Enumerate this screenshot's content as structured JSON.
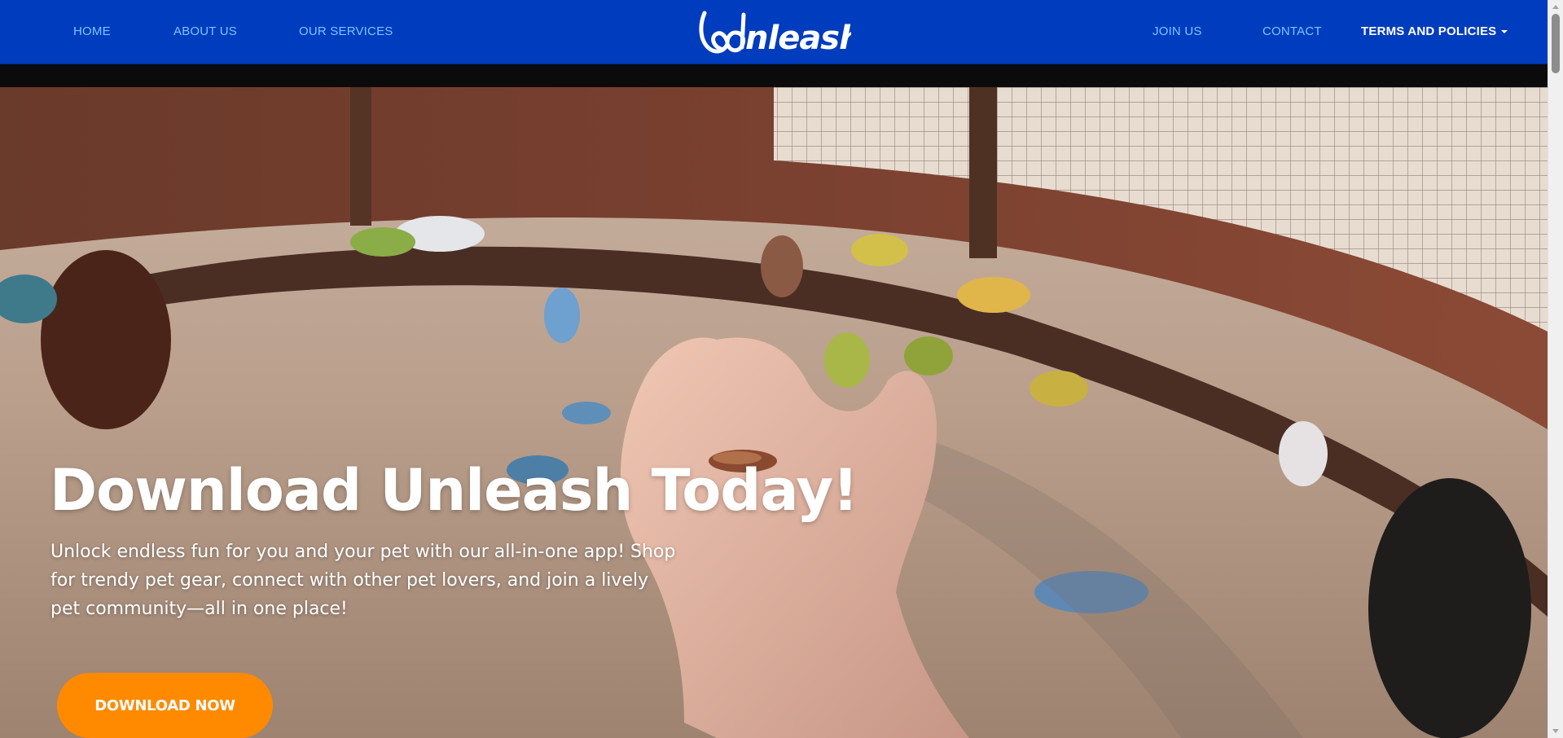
{
  "nav": {
    "home": "HOME",
    "about": "ABOUT US",
    "services": "OUR SERVICES",
    "join": "JOIN US",
    "contact": "CONTACT",
    "terms": "TERMS AND POLICIES"
  },
  "logo": {
    "text": "Unleash",
    "icon": "heart-icon"
  },
  "hero": {
    "title": "Download Unleash Today!",
    "text": "Unlock endless fun for you and your pet with our all-in-one app! Shop for trendy pet gear, connect with other pet lovers, and join a lively pet community—all in one place!",
    "button": "DOWNLOAD NOW",
    "background": "hand-feeding-birds-photo"
  },
  "colors": {
    "nav_bg": "#003cbe",
    "nav_link": "#7fc3ff",
    "accent": "#ff8a00"
  }
}
